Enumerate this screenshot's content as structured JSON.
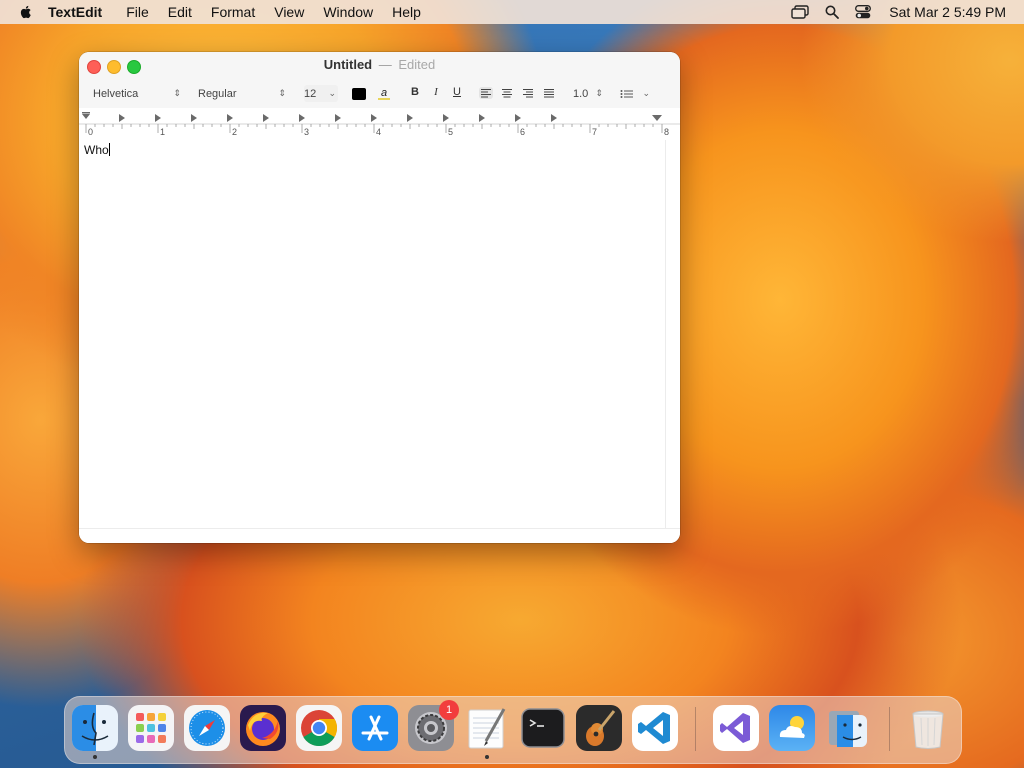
{
  "menubar": {
    "app_name": "TextEdit",
    "items": [
      "File",
      "Edit",
      "Format",
      "View",
      "Window",
      "Help"
    ],
    "clock": "Sat Mar 2  5:49 PM"
  },
  "window": {
    "title": "Untitled",
    "separator": "—",
    "status": "Edited"
  },
  "toolbar": {
    "font_family": "Helvetica",
    "font_style": "Regular",
    "font_size": "12",
    "text_color": "#000000",
    "bold": "B",
    "italic": "I",
    "underline": "U",
    "line_spacing": "1.0",
    "bg_color_glyph": "a"
  },
  "ruler": {
    "labels": [
      "0",
      "1",
      "2",
      "3",
      "4",
      "5",
      "6",
      "7",
      "8"
    ]
  },
  "document": {
    "text": "Who"
  },
  "dock": {
    "apps": [
      {
        "name": "Finder",
        "icon": "finder-icon",
        "running": true
      },
      {
        "name": "Launchpad",
        "icon": "launchpad-icon",
        "running": false
      },
      {
        "name": "Safari",
        "icon": "safari-icon",
        "running": false
      },
      {
        "name": "Firefox",
        "icon": "firefox-icon",
        "running": false
      },
      {
        "name": "Chrome",
        "icon": "chrome-icon",
        "running": false
      },
      {
        "name": "App Store",
        "icon": "app-store-icon",
        "running": false
      },
      {
        "name": "System Settings",
        "icon": "system-settings-icon",
        "running": false,
        "badge": "1"
      },
      {
        "name": "TextEdit",
        "icon": "textedit-icon",
        "running": true
      },
      {
        "name": "Terminal",
        "icon": "terminal-icon",
        "running": false
      },
      {
        "name": "GarageBand",
        "icon": "garageband-icon",
        "running": false
      },
      {
        "name": "Visual Studio Code",
        "icon": "vscode-icon",
        "running": false
      },
      {
        "name": "Visual Studio",
        "icon": "visual-studio-icon",
        "running": false
      },
      {
        "name": "Weather",
        "icon": "weather-icon",
        "running": false
      },
      {
        "name": "Finder Folder",
        "icon": "finder-folder-icon",
        "running": false
      },
      {
        "name": "Trash",
        "icon": "trash-icon",
        "running": false
      }
    ]
  }
}
